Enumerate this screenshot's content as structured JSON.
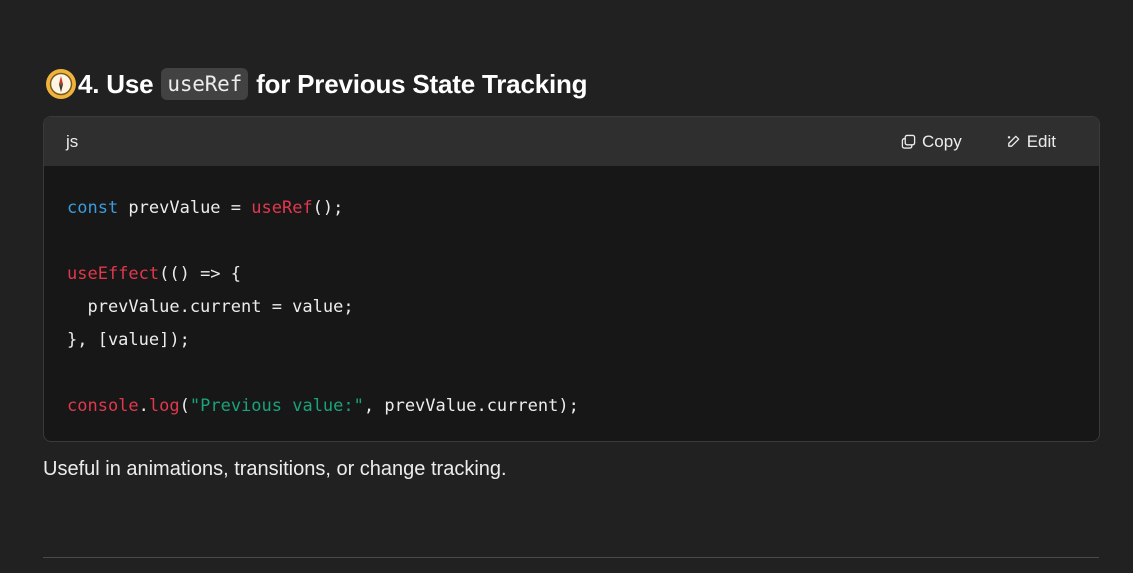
{
  "heading": {
    "icon": "compass-icon",
    "prefix": "4. Use",
    "code": "useRef",
    "suffix": "for Previous State Tracking"
  },
  "code_block": {
    "language": "js",
    "copy_label": "Copy",
    "edit_label": "Edit",
    "lines": [
      [
        {
          "t": "const",
          "c": "kw"
        },
        {
          "t": " prevValue = "
        },
        {
          "t": "useRef",
          "c": "fn"
        },
        {
          "t": "();"
        }
      ],
      [],
      [
        {
          "t": "useEffect",
          "c": "fn"
        },
        {
          "t": "(() => {"
        }
      ],
      [
        {
          "t": "  prevValue.current = value;"
        }
      ],
      [
        {
          "t": "}, [value]);"
        }
      ],
      [],
      [
        {
          "t": "console",
          "c": "fn"
        },
        {
          "t": "."
        },
        {
          "t": "log",
          "c": "fn"
        },
        {
          "t": "("
        },
        {
          "t": "\"Previous value:\"",
          "c": "str"
        },
        {
          "t": ", prevValue.current);"
        }
      ]
    ]
  },
  "paragraph": "Useful in animations, transitions, or change tracking.",
  "colors": {
    "background": "#212121",
    "code_header": "#2f2f2f",
    "code_body": "#171717",
    "keyword": "#3b9bdb",
    "function": "#e0384d",
    "string": "#19a37a"
  }
}
